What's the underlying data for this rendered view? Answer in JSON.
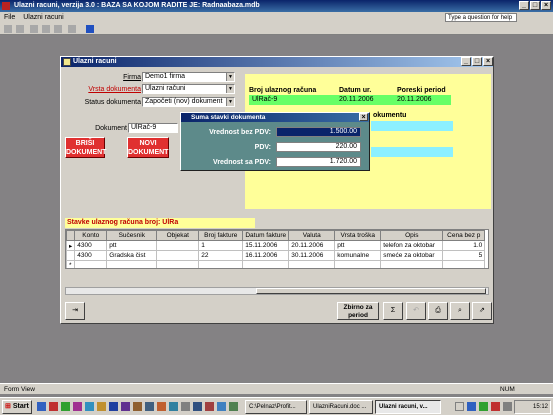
{
  "app": {
    "title": "Ulazni racuni, verzija 3.0 : BAZA SA KOJOM RADITE JE: Radnaabaza.mdb",
    "menu": [
      "File",
      "Ulazni racuni"
    ],
    "help_placeholder": "Type a question for help"
  },
  "window": {
    "title": "Ulazni racuni"
  },
  "form": {
    "firma_label": "Firma",
    "firma_value": "Demo1 firma",
    "vrsta_label": "Vrsta dokumenta",
    "vrsta_value": "Ulazni računi",
    "status_label": "Status dokumenta",
    "status_value": "Započeti (nov) dokument",
    "dokument_label": "Dokument",
    "dokument_value": "UlRač-9",
    "brisi_line1": "BRIŠI",
    "brisi_line2": "DOKUMENT",
    "novi_line1": "NOVI",
    "novi_line2": "DOKUMENT"
  },
  "header_panel": {
    "broj_label": "Broj ulaznog računa",
    "datum_label": "Datum ur.",
    "poreski_label": "Poreski period",
    "broj_value": "UlRač-9",
    "datum_value": "20.11.2006",
    "poreski_value": "20.11.2006",
    "dokumentu_label": "okumentu"
  },
  "subform": {
    "title": "Stavke ulaznog računa broj: UlRa",
    "columns": [
      "Konto",
      "Sučesnik",
      "Objekat",
      "Broj fakture",
      "Datum fakture",
      "Valuta",
      "Vrsta troška",
      "Opis",
      "Cena bez p"
    ],
    "rows": [
      [
        "4300",
        "ptt",
        "",
        "1",
        "15.11.2006",
        "20.11.2006",
        "ptt",
        "telefon za oktobar",
        "1.0"
      ],
      [
        "4300",
        "Gradska čist",
        "",
        "22",
        "16.11.2006",
        "30.11.2006",
        "komunalne",
        "smeće za oktobar",
        "5"
      ]
    ]
  },
  "popup": {
    "title": "Suma stavki dokumenta",
    "bez_label": "Vrednost bez PDV:",
    "bez_value": "1.500.00",
    "pdv_label": "PDV:",
    "pdv_value": "220.00",
    "sa_label": "Vrednost sa PDV:",
    "sa_value": "1.720.00"
  },
  "bottom": {
    "zbirno_line1": "Zbirno za",
    "zbirno_line2": "period"
  },
  "status": {
    "left": "Form View",
    "right": "NUM"
  },
  "taskbar": {
    "start": "Start",
    "tasks": [
      "C:\\Pelnaz\\Profit...",
      "UlazniRacuni.doc ...",
      "Ulazni racuni, v..."
    ],
    "clock": "15:12"
  }
}
